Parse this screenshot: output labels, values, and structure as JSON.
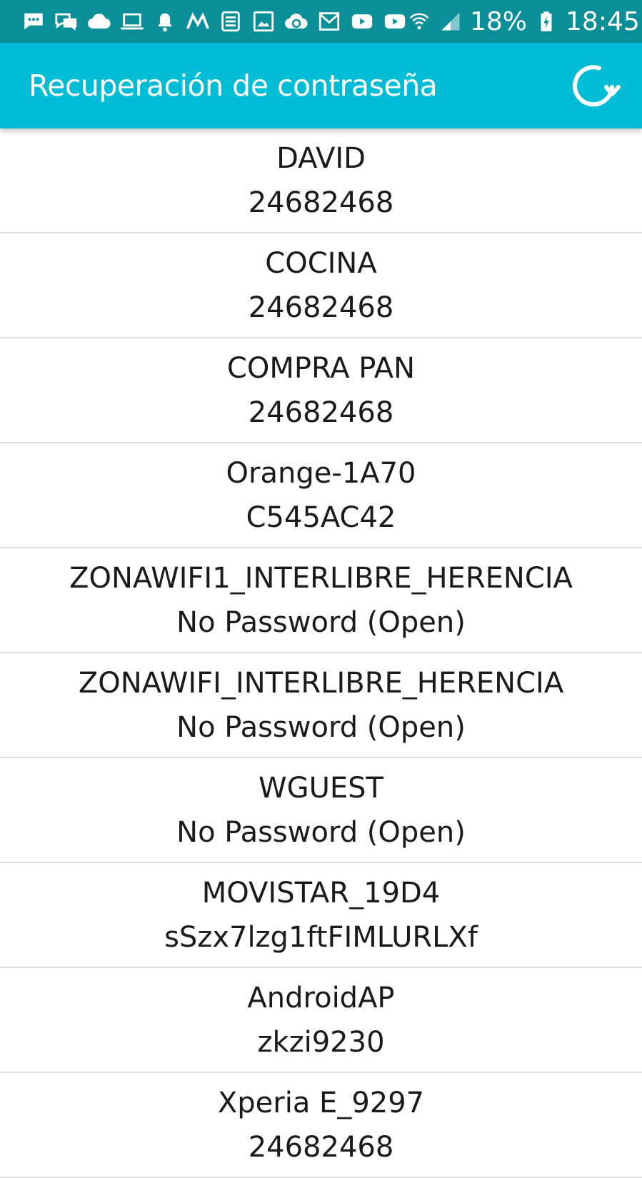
{
  "status_bar": {
    "notification_icons": [
      "messages-icon",
      "chat-icon",
      "cloud-icon",
      "laptop-icon",
      "bell-icon",
      "m-app-icon",
      "list-app-icon",
      "image-icon",
      "sync-icon",
      "mail-icon",
      "youtube-icon",
      "youtube-icon"
    ],
    "battery_percent": "18%",
    "time": "18:45"
  },
  "app_bar": {
    "title": "Recuperación de contraseña",
    "refresh_icon": "refresh-icon",
    "background": "#00bcd4"
  },
  "networks": [
    {
      "ssid": "DAVID",
      "password": "24682468"
    },
    {
      "ssid": "COCINA",
      "password": "24682468"
    },
    {
      "ssid": "COMPRA PAN",
      "password": "24682468"
    },
    {
      "ssid": "Orange-1A70",
      "password": "C545AC42"
    },
    {
      "ssid": "ZONAWIFI1_INTERLIBRE_HERENCIA",
      "password": "No Password (Open)"
    },
    {
      "ssid": "ZONAWIFI_INTERLIBRE_HERENCIA",
      "password": "No Password (Open)"
    },
    {
      "ssid": "WGUEST",
      "password": "No Password (Open)"
    },
    {
      "ssid": "MOVISTAR_19D4",
      "password": "sSzx7lzg1ftFIMLURLXf"
    },
    {
      "ssid": "AndroidAP",
      "password": "zkzi9230"
    },
    {
      "ssid": "Xperia E_9297",
      "password": "24682468"
    }
  ]
}
